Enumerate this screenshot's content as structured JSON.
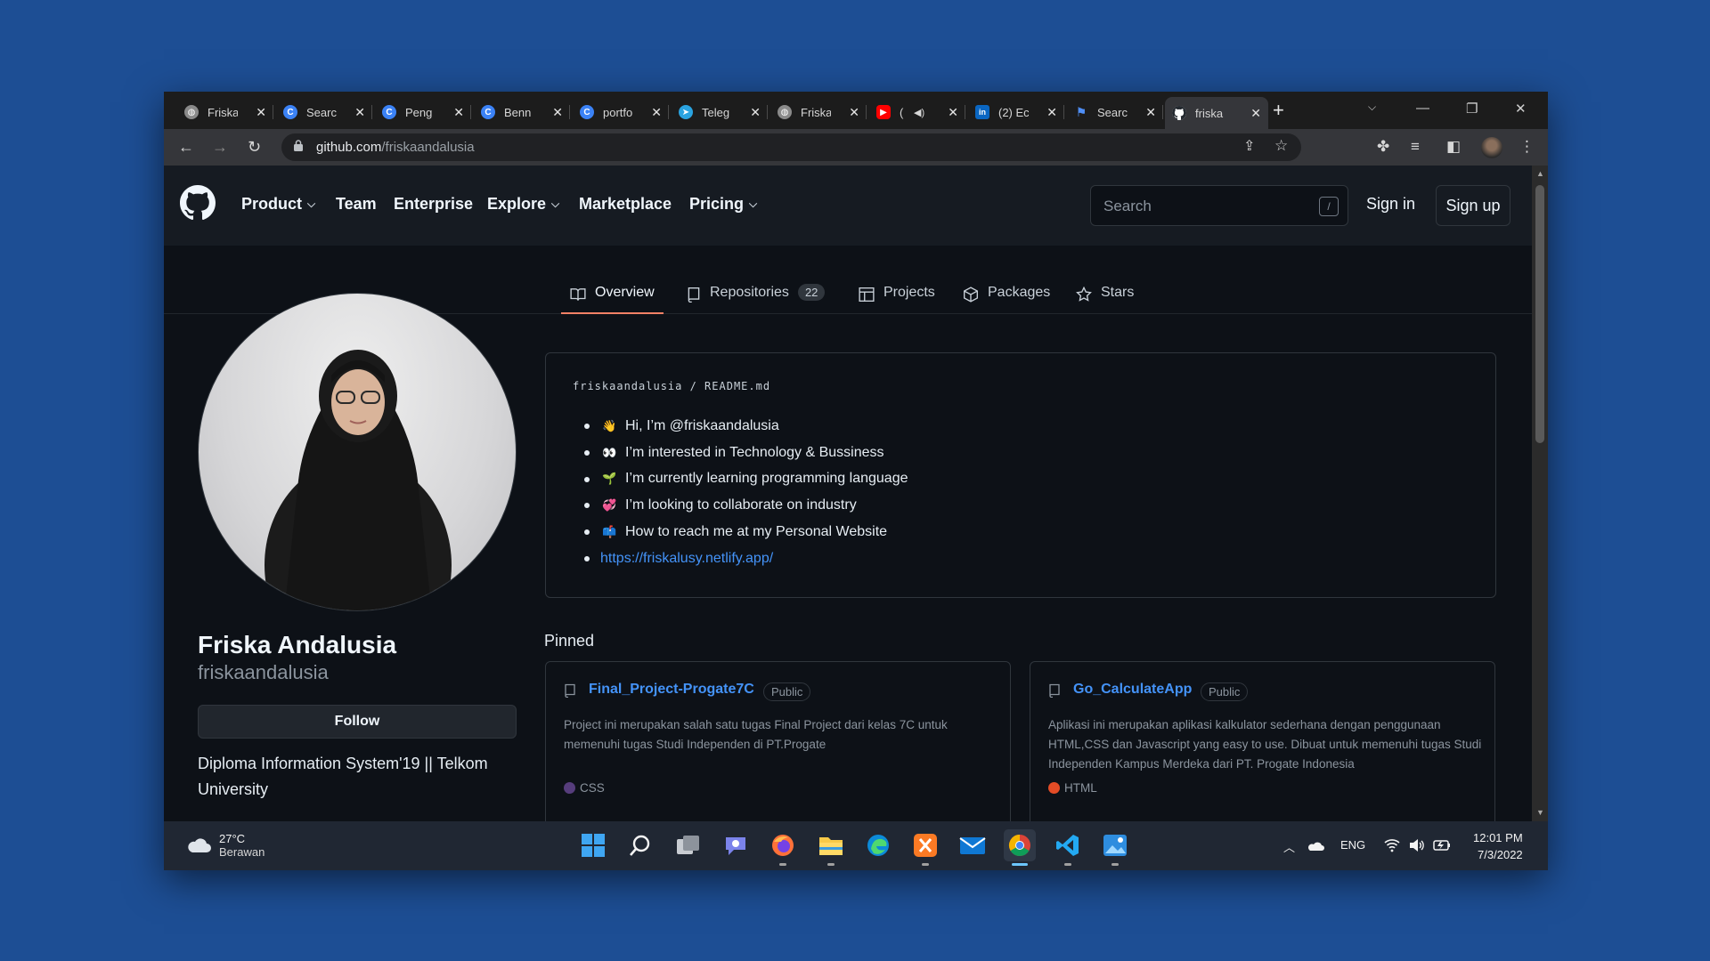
{
  "browser": {
    "tabs": [
      {
        "title": "Friska",
        "icon": "globe-icon",
        "icon_color": "#8a8a8a"
      },
      {
        "title": "Search",
        "icon": "c-icon",
        "icon_color": "#3b82f6"
      },
      {
        "title": "Peng",
        "icon": "c-icon",
        "icon_color": "#3b82f6"
      },
      {
        "title": "Benn",
        "icon": "c-icon",
        "icon_color": "#3b82f6"
      },
      {
        "title": "portfo",
        "icon": "c-icon",
        "icon_color": "#3b82f6"
      },
      {
        "title": "Teleg",
        "icon": "telegram-icon",
        "icon_color": "#2aa3e0"
      },
      {
        "title": "Friska",
        "icon": "globe-icon",
        "icon_color": "#8a8a8a"
      },
      {
        "title": "(",
        "icon": "youtube-icon",
        "icon_color": "#ff0000"
      },
      {
        "title": "(2) Ec",
        "icon": "linkedin-icon",
        "icon_color": "#0a66c2"
      },
      {
        "title": "Search",
        "icon": "flag-icon",
        "icon_color": "#4f8ff7"
      },
      {
        "title": "friska",
        "icon": "github-icon",
        "icon_color": "#ffffff"
      }
    ],
    "url_host": "github.com",
    "url_path": "/friskaandalusia"
  },
  "header": {
    "nav": [
      "Product",
      "Team",
      "Enterprise",
      "Explore",
      "Marketplace",
      "Pricing"
    ],
    "search_placeholder": "Search",
    "search_key": "/",
    "signin": "Sign in",
    "signup": "Sign up"
  },
  "profile_tabs": {
    "overview": "Overview",
    "repositories": "Repositories",
    "repo_count": "22",
    "projects": "Projects",
    "packages": "Packages",
    "stars": "Stars"
  },
  "profile": {
    "name": "Friska Andalusia",
    "login": "friskaandalusia",
    "follow": "Follow",
    "bio": "Diploma Information System'19 || Telkom University"
  },
  "readme": {
    "path": "friskaandalusia / README.md",
    "items": [
      {
        "emoji": "👋",
        "text": "Hi, I’m @friskaandalusia"
      },
      {
        "emoji": "👀",
        "text": "I’m interested in Technology & Bussiness"
      },
      {
        "emoji": "🌱",
        "text": "I’m currently learning programming language"
      },
      {
        "emoji": "💞",
        "text": "I’m looking to collaborate on industry"
      },
      {
        "emoji": "📫",
        "text": "How to reach me at my Personal Website"
      }
    ],
    "link": "https://friskalusy.netlify.app/"
  },
  "pinned": {
    "title": "Pinned",
    "cards": [
      {
        "name": "Final_Project-Progate7C",
        "badge": "Public",
        "description": "Project ini merupakan salah satu tugas Final Project dari kelas 7C untuk memenuhi tugas Studi Independen di PT.Progate",
        "language": "CSS",
        "language_color": "#563d7c"
      },
      {
        "name": "Go_CalculateApp",
        "badge": "Public",
        "description": "Aplikasi ini merupakan aplikasi kalkulator sederhana dengan penggunaan HTML,CSS dan Javascript yang easy to use. Dibuat untuk memenuhi tugas Studi Independen Kampus Merdeka dari PT. Progate Indonesia",
        "language": "HTML",
        "language_color": "#e34c26"
      }
    ]
  },
  "taskbar": {
    "temperature": "27°C",
    "condition": "Berawan",
    "language": "ENG",
    "time": "12:01 PM",
    "date": "7/3/2022"
  }
}
